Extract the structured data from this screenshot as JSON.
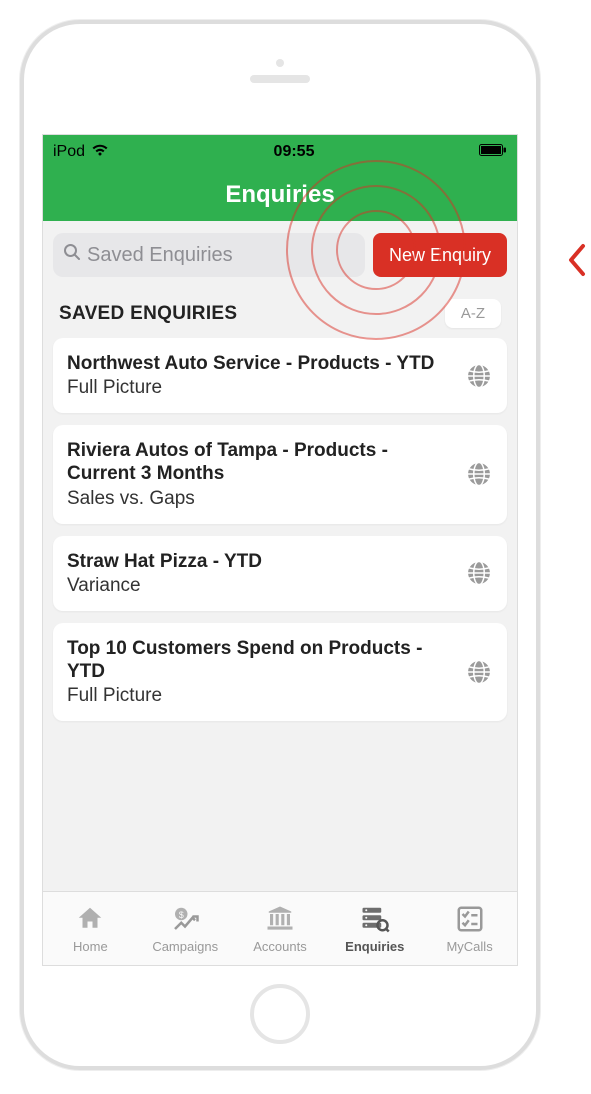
{
  "statusBar": {
    "device": "iPod",
    "time": "09:55"
  },
  "header": {
    "title": "Enquiries"
  },
  "search": {
    "placeholder": "Saved Enquiries",
    "newButton": "New Enquiry"
  },
  "section": {
    "title": "SAVED ENQUIRIES",
    "sort": "A-Z"
  },
  "items": [
    {
      "title": "Northwest Auto Service - Products - YTD",
      "sub": "Full Picture"
    },
    {
      "title": "Riviera Autos of Tampa - Products - Current 3 Months",
      "sub": "Sales vs. Gaps"
    },
    {
      "title": "Straw Hat Pizza - YTD",
      "sub": "Variance"
    },
    {
      "title": "Top 10 Customers Spend on Products - YTD",
      "sub": "Full Picture"
    }
  ],
  "tabs": [
    {
      "label": "Home"
    },
    {
      "label": "Campaigns"
    },
    {
      "label": "Accounts"
    },
    {
      "label": "Enquiries"
    },
    {
      "label": "MyCalls"
    }
  ],
  "activeTab": 3
}
